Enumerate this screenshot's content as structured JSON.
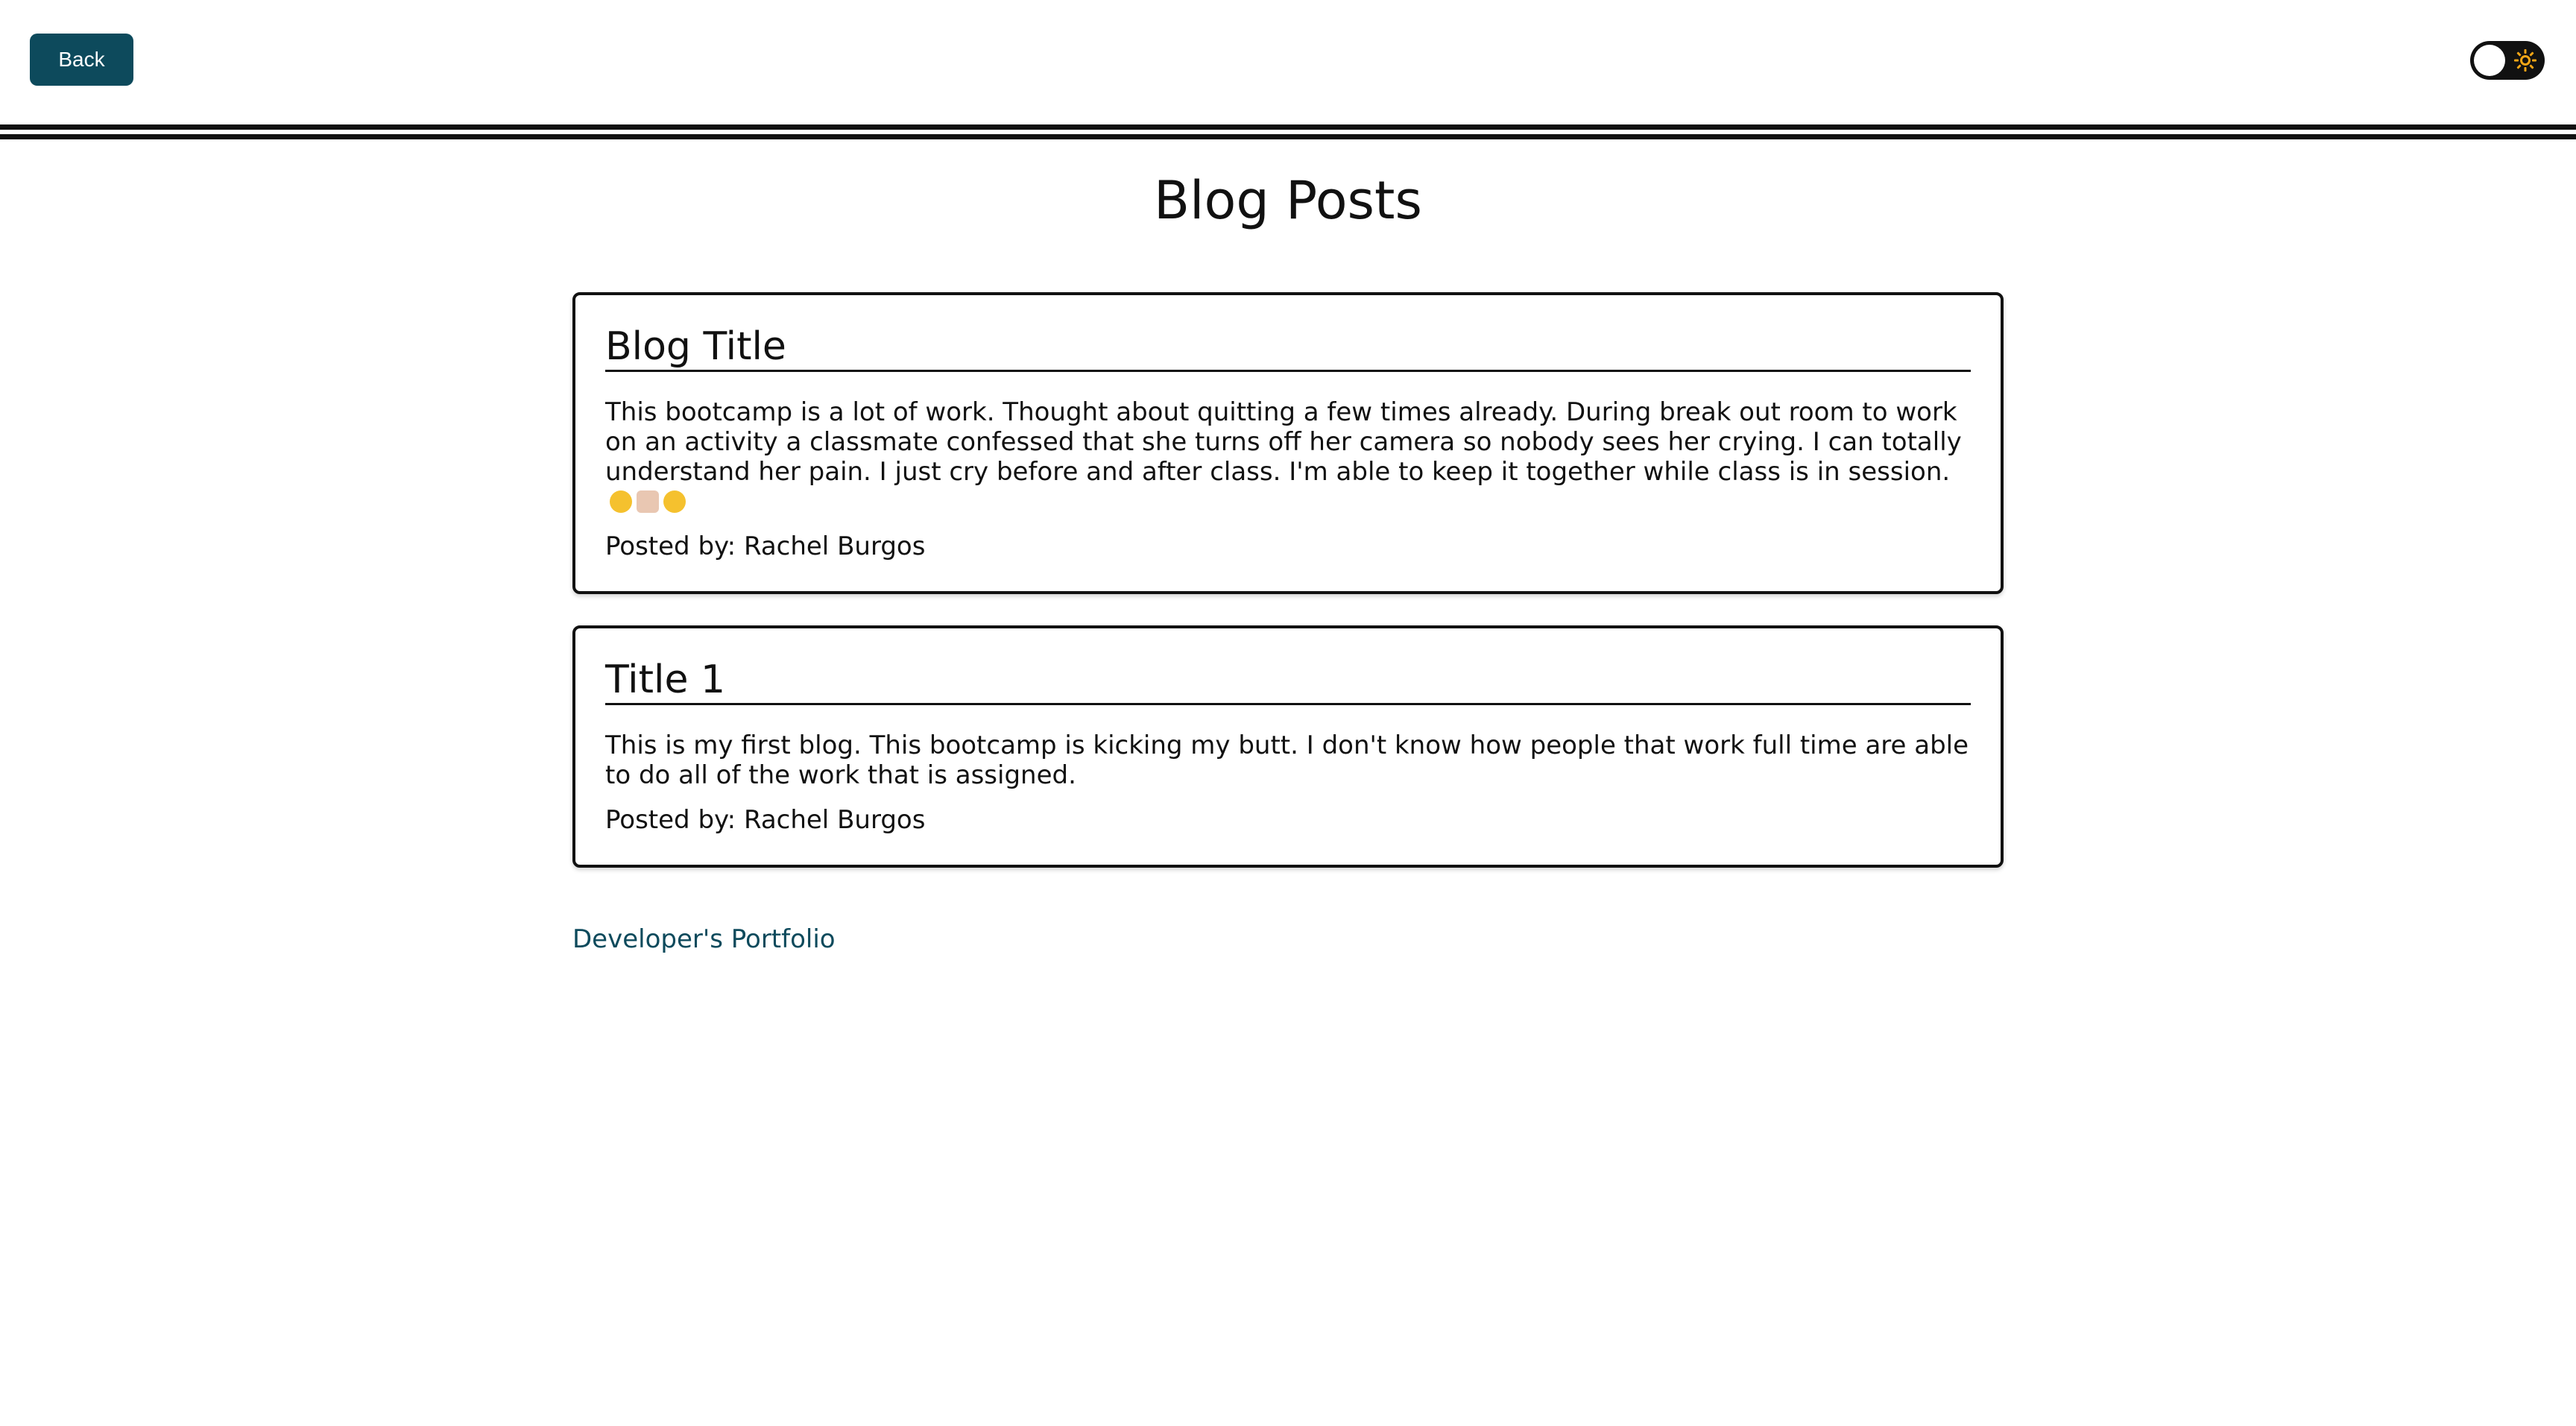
{
  "header": {
    "back_label": "Back"
  },
  "page": {
    "title": "Blog Posts"
  },
  "posts": [
    {
      "title": "Blog Title",
      "body": "This bootcamp is a lot of work. Thought about quitting a few times already. During break out room to work on an activity a classmate confessed that she turns off her camera so nobody sees her crying. I can totally understand her pain. I just cry before and after class. I'm able to keep it together while class is in session.",
      "emojis": [
        "laughing-crying-emoji",
        "woman-facepalming-emoji",
        "pleading-face-emoji"
      ],
      "author": "Posted by: Rachel Burgos"
    },
    {
      "title": "Title 1",
      "body": "This is my first blog. This bootcamp is kicking my butt. I don't know how people that work full time are able to do all of the work that is assigned.",
      "author": "Posted by: Rachel Burgos"
    }
  ],
  "footer": {
    "link_label": "Developer's Portfolio"
  },
  "colors": {
    "accent": "#0d4a5c",
    "sun": "#f2a516",
    "border": "#111111"
  }
}
